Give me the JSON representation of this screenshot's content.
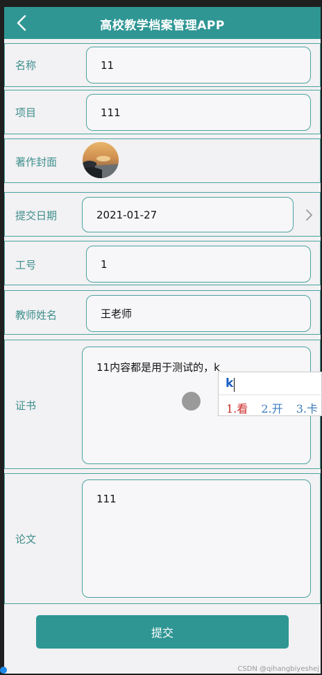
{
  "header": {
    "title": "高校教学档案管理APP",
    "back_icon": "chevron-left-icon"
  },
  "form": {
    "name": {
      "label": "名称",
      "value": "11"
    },
    "project": {
      "label": "项目",
      "value": "111"
    },
    "cover": {
      "label": "著作封面",
      "image": "lake-sunset-thumbnail"
    },
    "submit_date": {
      "label": "提交日期",
      "value": "2021-01-27",
      "icon": "chevron-right-icon"
    },
    "employee_id": {
      "label": "工号",
      "value": "1"
    },
    "teacher_name": {
      "label": "教师姓名",
      "value": "王老师"
    },
    "certificate": {
      "label": "证书",
      "value": "11内容都是用于测试的，k"
    },
    "paper": {
      "label": "论文",
      "value": "111"
    }
  },
  "ime": {
    "input": "k",
    "candidates": [
      "1.看",
      "2.开",
      "3.卡"
    ]
  },
  "submit_label": "提交",
  "watermark": "CSDN @qihangbiyeshej",
  "colors": {
    "primary": "#2f9694",
    "border": "#4aa3a0",
    "label": "#3d8f8c",
    "background": "#f2f1f3"
  }
}
